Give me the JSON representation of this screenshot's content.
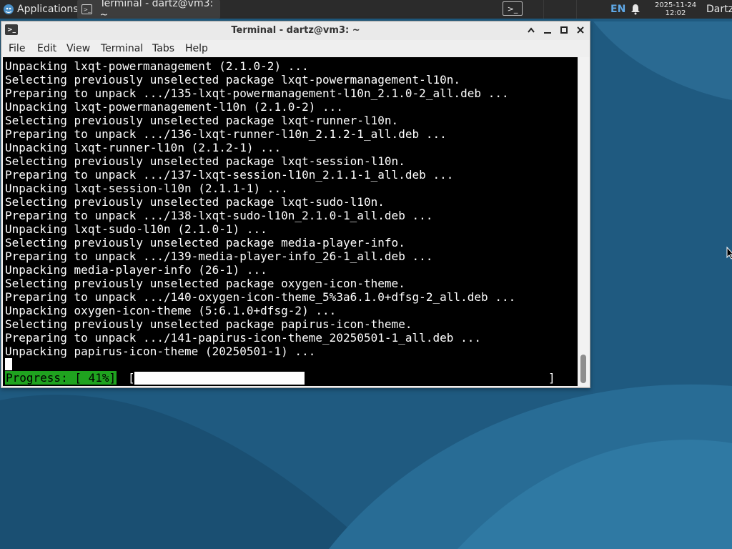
{
  "panel": {
    "apps_label": "Applications",
    "task_label": "Terminal - dartz@vm3: ~",
    "lang": "EN",
    "date": "2025-11-24",
    "time": "12:02",
    "user": "Dartz"
  },
  "window": {
    "title": "Terminal - dartz@vm3: ~",
    "menu": [
      "File",
      "Edit",
      "View",
      "Terminal",
      "Tabs",
      "Help"
    ]
  },
  "terminal": {
    "lines": [
      "Unpacking lxqt-powermanagement (2.1.0-2) ...",
      "Selecting previously unselected package lxqt-powermanagement-l10n.",
      "Preparing to unpack .../135-lxqt-powermanagement-l10n_2.1.0-2_all.deb ...",
      "Unpacking lxqt-powermanagement-l10n (2.1.0-2) ...",
      "Selecting previously unselected package lxqt-runner-l10n.",
      "Preparing to unpack .../136-lxqt-runner-l10n_2.1.2-1_all.deb ...",
      "Unpacking lxqt-runner-l10n (2.1.2-1) ...",
      "Selecting previously unselected package lxqt-session-l10n.",
      "Preparing to unpack .../137-lxqt-session-l10n_2.1.1-1_all.deb ...",
      "Unpacking lxqt-session-l10n (2.1.1-1) ...",
      "Selecting previously unselected package lxqt-sudo-l10n.",
      "Preparing to unpack .../138-lxqt-sudo-l10n_2.1.0-1_all.deb ...",
      "Unpacking lxqt-sudo-l10n (2.1.0-1) ...",
      "Selecting previously unselected package media-player-info.",
      "Preparing to unpack .../139-media-player-info_26-1_all.deb ...",
      "Unpacking media-player-info (26-1) ...",
      "Selecting previously unselected package oxygen-icon-theme.",
      "Preparing to unpack .../140-oxygen-icon-theme_5%3a6.1.0+dfsg-2_all.deb ...",
      "Unpacking oxygen-icon-theme (5:6.1.0+dfsg-2) ...",
      "Selecting previously unselected package papirus-icon-theme.",
      "Preparing to unpack .../141-papirus-icon-theme_20250501-1_all.deb ...",
      "Unpacking papirus-icon-theme (20250501-1) ..."
    ],
    "progress_label": "Progress: [ 41%]",
    "progress_fraction": 0.41,
    "bracket_open": "[",
    "bracket_close": "]"
  },
  "colors": {
    "panel_bg": "#2b2b2b",
    "terminal_bg": "#000000",
    "progress_label_bg": "#1fa31f",
    "lang_accent": "#5fa8e6",
    "desktop_bg": "#1f5a80"
  },
  "icons": {
    "apps": "xfce-mouse-icon",
    "terminal": "terminal-icon",
    "bell": "bell-icon"
  }
}
